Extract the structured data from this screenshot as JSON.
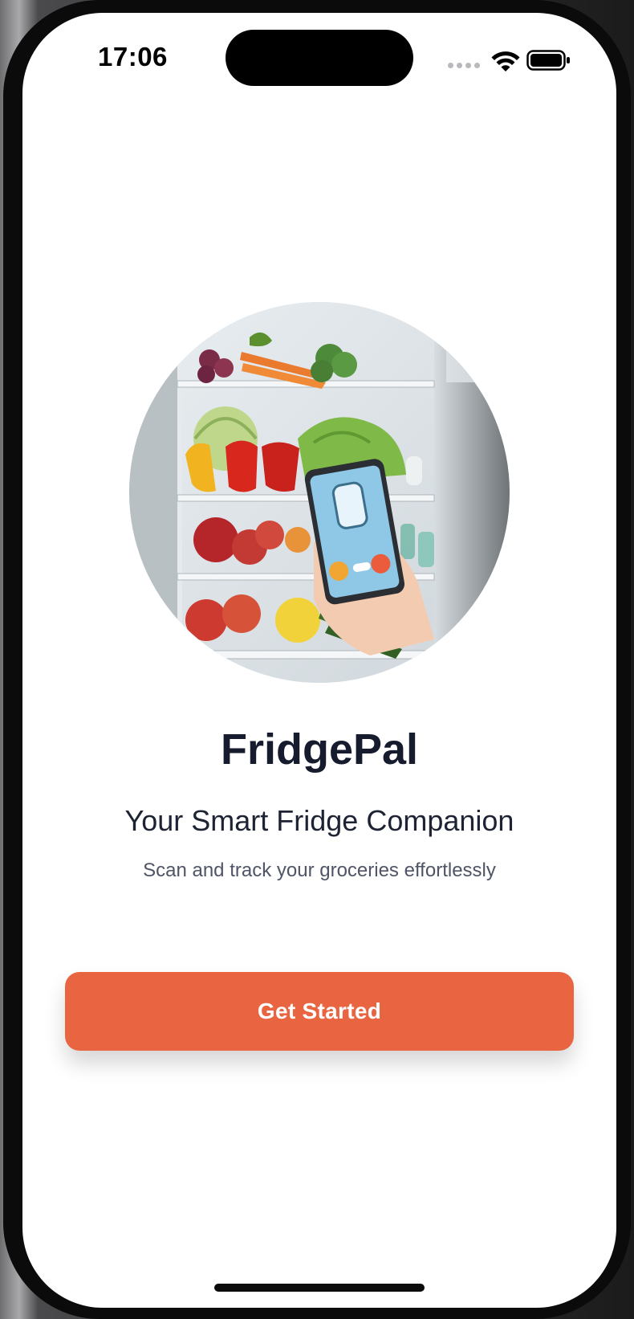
{
  "status_bar": {
    "time": "17:06"
  },
  "app": {
    "name": "FridgePal",
    "tagline": "Your Smart Fridge Companion",
    "subtitle": "Scan and track your groceries effortlessly",
    "cta_label": "Get Started"
  },
  "colors": {
    "accent": "#e96542",
    "title": "#161b2e",
    "background": "#ffffff"
  },
  "hero_image": {
    "description_icon": "fridge-with-phone-illustration"
  }
}
